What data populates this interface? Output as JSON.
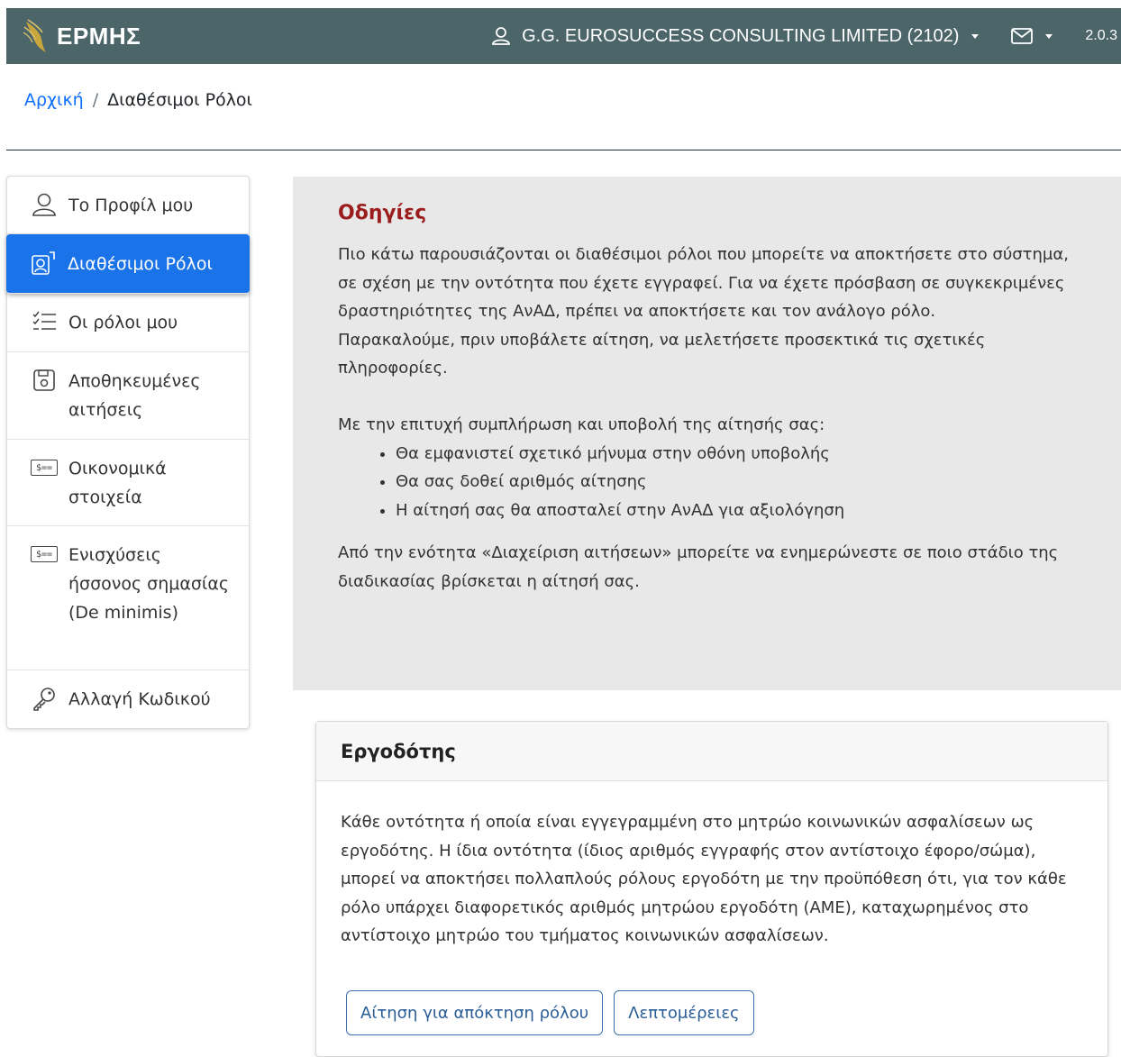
{
  "navbar": {
    "brand": "ΕΡΜΗΣ",
    "user": "G.G. EUROSUCCESS CONSULTING LIMITED (2102)",
    "version": "2.0.3",
    "colors": {
      "background": "#4c6569",
      "logo": "#c8a53d"
    }
  },
  "breadcrumb": {
    "home": "Αρχική",
    "separator": "/",
    "current": "Διαθέσιμοι Ρόλοι"
  },
  "sidebar": {
    "items": [
      {
        "label": "Το Προφίλ μου",
        "icon": "user-icon",
        "active": false
      },
      {
        "label": "Διαθέσιμοι Ρόλοι",
        "icon": "roles-icon",
        "active": true
      },
      {
        "label": "Οι ρόλοι μου",
        "icon": "list-check-icon",
        "active": false
      },
      {
        "label": "Αποθηκευμένες αιτήσεις",
        "icon": "save-icon",
        "active": false
      },
      {
        "label": "Οικονομικά στοιχεία",
        "icon": "money-icon",
        "active": false
      },
      {
        "label": "Ενισχύσεις ήσσονος σημασίας (De minimis)",
        "icon": "money-icon",
        "active": false
      },
      {
        "label": "Αλλαγή Κωδικού",
        "icon": "key-icon",
        "active": false
      }
    ],
    "colors": {
      "active": "#1a73e8"
    }
  },
  "instructions": {
    "title": "Οδηγίες",
    "p1": "Πιο κάτω παρουσιάζονται οι διαθέσιμοι ρόλοι που μπορείτε να αποκτήσετε στο σύστημα, σε σχέση με την οντότητα που έχετε εγγραφεί. Για να έχετε πρόσβαση σε συγκεκριμένες δραστηριότητες της ΑνΑΔ, πρέπει να αποκτήσετε και τον ανάλογο ρόλο.",
    "p2": "Παρακαλούμε, πριν υποβάλετε αίτηση, να μελετήσετε προσεκτικά τις σχετικές πληροφορίες.",
    "p3": "Με την επιτυχή συμπλήρωση και υποβολή της αίτησής σας:",
    "bullets": [
      "Θα εμφανιστεί σχετικό μήνυμα στην οθόνη υποβολής",
      "Θα σας δοθεί αριθμός αίτησης",
      "Η αίτησή σας θα αποσταλεί στην ΑνΑΔ για αξιολόγηση"
    ],
    "p4": "Από την ενότητα «Διαχείριση αιτήσεων» μπορείτε να ενημερώνεστε σε ποιο στάδιο της διαδικασίας βρίσκεται η αίτησή σας.",
    "colors": {
      "title": "#9b1c1c",
      "background": "#e8e8e8"
    }
  },
  "card": {
    "title": "Εργοδότης",
    "body": "Κάθε οντότητα ή οποία είναι εγγεγραμμένη στο μητρώο κοινωνικών ασφαλίσεων ως εργοδότης. Η ίδια οντότητα (ίδιος αριθμός εγγραφής στον αντίστοιχο έφορο/σώμα), μπορεί να αποκτήσει πολλαπλούς ρόλους εργοδότη με την προϋπόθεση ότι, για τον κάθε ρόλο υπάρχει διαφορετικός αριθμός μητρώου εργοδότη (ΑΜΕ), καταχωρημένος στο αντίστοιχο μητρώο του τμήματος κοινωνικών ασφαλίσεων.",
    "apply_button": "Αίτηση για απόκτηση ρόλου",
    "details_button": "Λεπτομέρειες"
  }
}
